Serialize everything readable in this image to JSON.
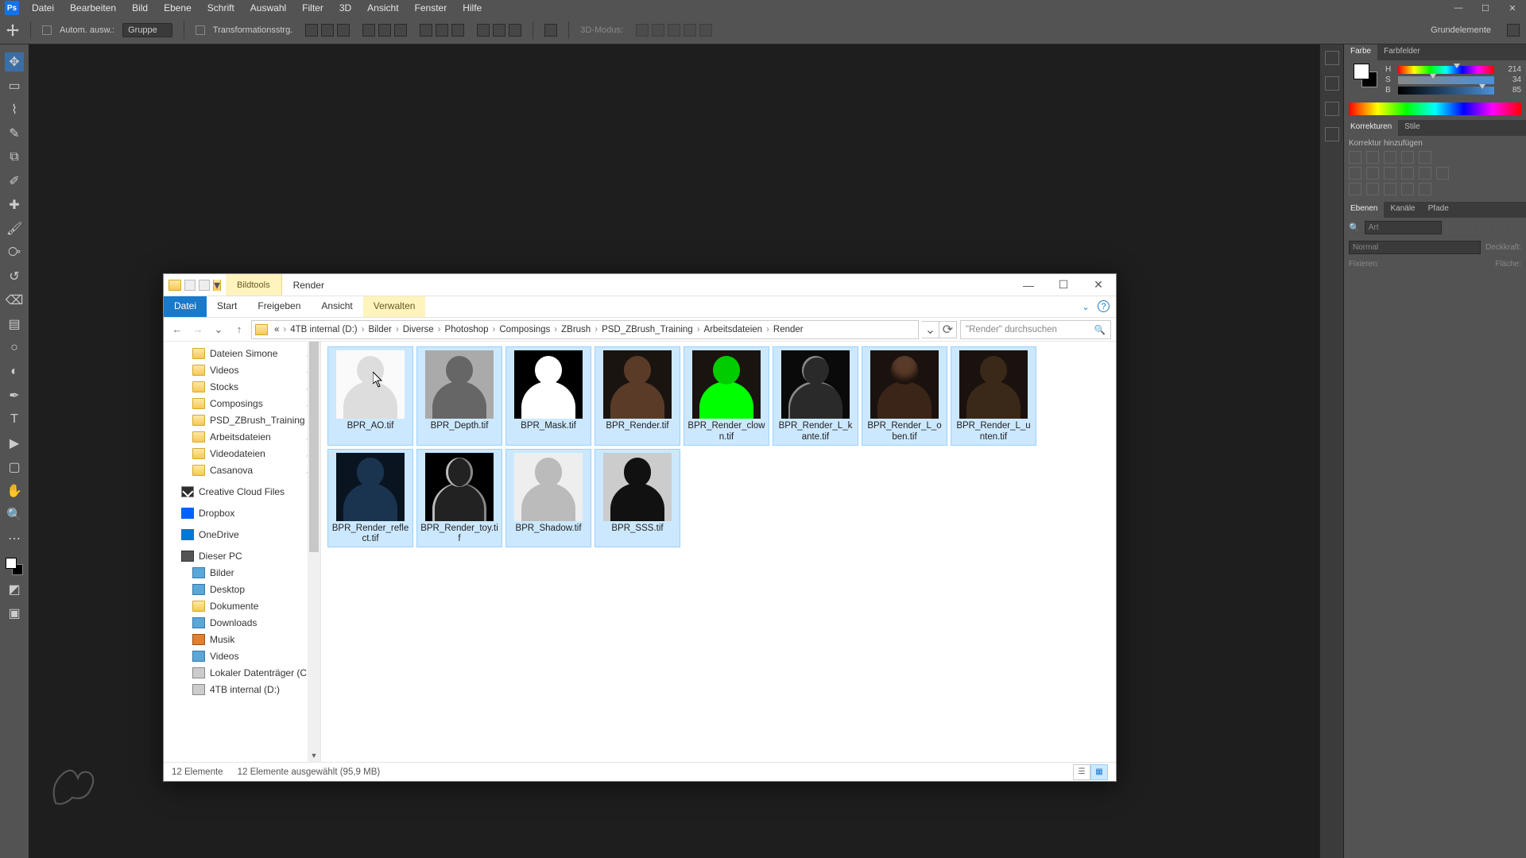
{
  "ps_menu": [
    "Datei",
    "Bearbeiten",
    "Bild",
    "Ebene",
    "Schrift",
    "Auswahl",
    "Filter",
    "3D",
    "Ansicht",
    "Fenster",
    "Hilfe"
  ],
  "optbar": {
    "auto_select": "Autom. ausw.:",
    "group": "Gruppe",
    "transform": "Transformationsstrg.",
    "mode3d": "3D-Modus:",
    "right_label": "Grundelemente"
  },
  "panels": {
    "color_tab": "Farbe",
    "swatches_tab": "Farbfelder",
    "hsb": {
      "h_label": "H",
      "h_val": "214",
      "s_label": "S",
      "s_val": "34",
      "b_label": "B",
      "b_val": "85"
    },
    "adjust_tab": "Korrekturen",
    "styles_tab": "Stile",
    "add_adjust": "Korrektur hinzufügen",
    "layers_tab": "Ebenen",
    "channels_tab": "Kanäle",
    "paths_tab": "Pfade",
    "search_placeholder": "Art",
    "blend": "Normal",
    "opacity_label": "Deckkraft:",
    "lock_label": "Fixieren:",
    "fill_label": "Fläche:"
  },
  "explorer": {
    "contextual_tab": "Bildtools",
    "title": "Render",
    "ribbon": {
      "file": "Datei",
      "start": "Start",
      "share": "Freigeben",
      "view": "Ansicht",
      "manage": "Verwalten"
    },
    "breadcrumbs": [
      "«",
      "4TB internal (D:)",
      "Bilder",
      "Diverse",
      "Photoshop",
      "Composings",
      "ZBrush",
      "PSD_ZBrush_Training",
      "Arbeitsdateien",
      "Render"
    ],
    "search_placeholder": "\"Render\" durchsuchen",
    "sidebar_quick": [
      {
        "label": "Dateien Simone",
        "pin": true
      },
      {
        "label": "Videos",
        "pin": true
      },
      {
        "label": "Stocks",
        "pin": true
      },
      {
        "label": "Composings",
        "pin": true
      },
      {
        "label": "PSD_ZBrush_Training",
        "pin": true
      },
      {
        "label": "Arbeitsdateien",
        "pin": true
      },
      {
        "label": "Videodateien",
        "pin": true
      },
      {
        "label": "Casanova",
        "pin": true
      }
    ],
    "sidebar_cc": "Creative Cloud Files",
    "sidebar_db": "Dropbox",
    "sidebar_od": "OneDrive",
    "sidebar_pc": "Dieser PC",
    "sidebar_pc_items": [
      {
        "label": "Bilder",
        "ic": "ic-img"
      },
      {
        "label": "Desktop",
        "ic": "ic-img"
      },
      {
        "label": "Dokumente",
        "ic": "ic-folder"
      },
      {
        "label": "Downloads",
        "ic": "ic-dl"
      },
      {
        "label": "Musik",
        "ic": "ic-music"
      },
      {
        "label": "Videos",
        "ic": "ic-img"
      },
      {
        "label": "Lokaler Datenträger (C:)",
        "ic": "ic-drive"
      },
      {
        "label": "4TB internal (D:)",
        "ic": "ic-drive"
      }
    ],
    "files": [
      {
        "name": "BPR_AO.tif",
        "cls": "white"
      },
      {
        "name": "BPR_Depth.tif",
        "cls": "grey"
      },
      {
        "name": "BPR_Mask.tif",
        "cls": "mask"
      },
      {
        "name": "BPR_Render.tif",
        "cls": "render"
      },
      {
        "name": "BPR_Render_clown.tif",
        "cls": "clown"
      },
      {
        "name": "BPR_Render_L_kante.tif",
        "cls": "lkante"
      },
      {
        "name": "BPR_Render_L_oben.tif",
        "cls": "loben"
      },
      {
        "name": "BPR_Render_L_unten.tif",
        "cls": "lunten"
      },
      {
        "name": "BPR_Render_reflect.tif",
        "cls": "reflect"
      },
      {
        "name": "BPR_Render_toy.tif",
        "cls": "toy"
      },
      {
        "name": "BPR_Shadow.tif",
        "cls": "shadow"
      },
      {
        "name": "BPR_SSS.tif",
        "cls": "sss"
      }
    ],
    "status_count": "12 Elemente",
    "status_sel": "12 Elemente ausgewählt (95,9 MB)"
  }
}
